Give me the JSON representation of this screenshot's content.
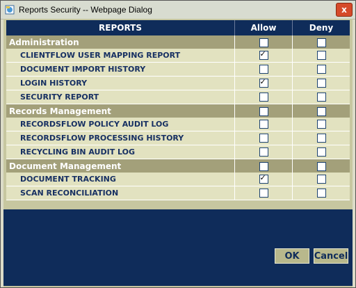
{
  "window": {
    "title": "Reports Security -- Webpage Dialog",
    "close_glyph": "x"
  },
  "table": {
    "headers": {
      "reports": "REPORTS",
      "allow": "Allow",
      "deny": "Deny"
    },
    "rows": [
      {
        "type": "group",
        "label": "Administration",
        "allow": false,
        "deny": false
      },
      {
        "type": "item",
        "label": "CLIENTFLOW USER MAPPING REPORT",
        "allow": true,
        "deny": false
      },
      {
        "type": "item",
        "label": "DOCUMENT IMPORT HISTORY",
        "allow": false,
        "deny": false
      },
      {
        "type": "item",
        "label": "LOGIN HISTORY",
        "allow": true,
        "deny": false
      },
      {
        "type": "item",
        "label": "SECURITY REPORT",
        "allow": false,
        "deny": false
      },
      {
        "type": "group",
        "label": "Records Management",
        "allow": false,
        "deny": false
      },
      {
        "type": "item",
        "label": "RECORDSFLOW POLICY AUDIT LOG",
        "allow": false,
        "deny": false
      },
      {
        "type": "item",
        "label": "RECORDSFLOW PROCESSING HISTORY",
        "allow": false,
        "deny": false
      },
      {
        "type": "item",
        "label": "RECYCLING BIN AUDIT LOG",
        "allow": false,
        "deny": false
      },
      {
        "type": "group",
        "label": "Document Management",
        "allow": false,
        "deny": false
      },
      {
        "type": "item",
        "label": "DOCUMENT TRACKING",
        "allow": true,
        "deny": false
      },
      {
        "type": "item",
        "label": "SCAN RECONCILIATION",
        "allow": false,
        "deny": false
      }
    ]
  },
  "buttons": {
    "ok": "OK",
    "cancel": "Cancel"
  },
  "colors": {
    "header_bg": "#0f2c5a",
    "group_bg": "#a3a07a",
    "item_bg": "#e2e2c0",
    "item_text": "#173062"
  }
}
